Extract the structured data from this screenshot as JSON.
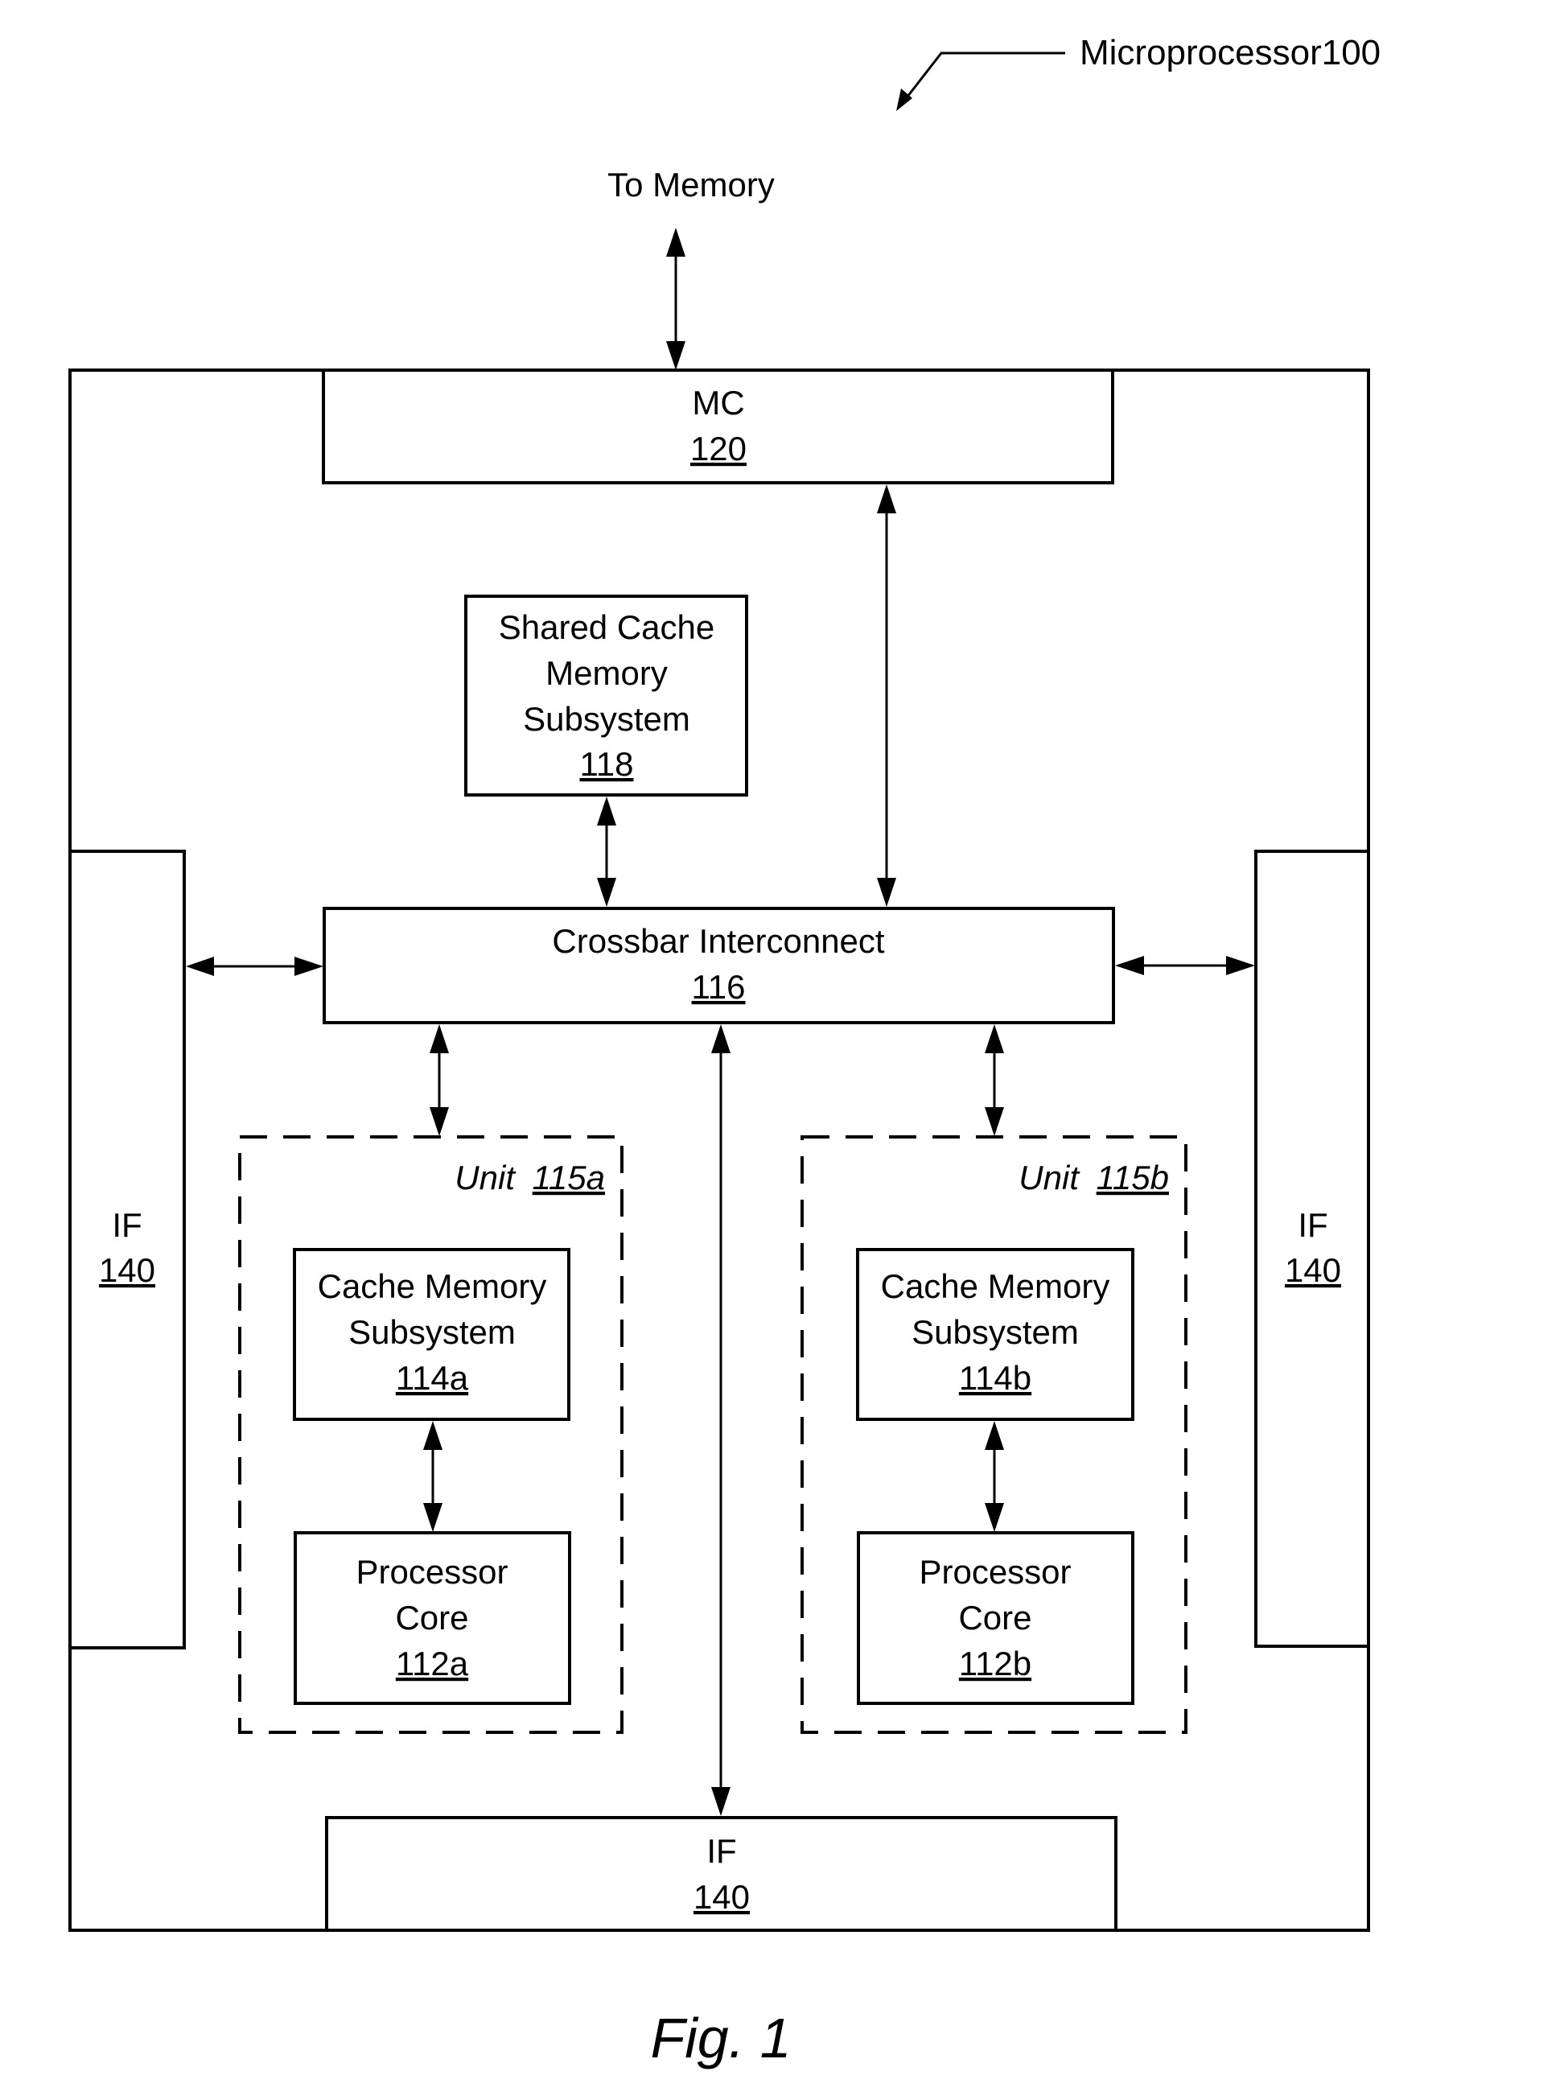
{
  "figure": {
    "reference_label": "Microprocessor100",
    "caption": "Fig. 1",
    "external_label": "To Memory"
  },
  "blocks": {
    "mc": {
      "name": "MC",
      "number": "120"
    },
    "shared_cache": {
      "lines": [
        "Shared Cache",
        "Memory",
        "Subsystem"
      ],
      "number": "118"
    },
    "crossbar": {
      "name": "Crossbar Interconnect",
      "number": "116"
    },
    "if_left": {
      "name": "IF",
      "number": "140"
    },
    "if_right": {
      "name": "IF",
      "number": "140"
    },
    "if_bottom": {
      "name": "IF",
      "number": "140"
    },
    "unit_a": {
      "label_prefix": "Unit",
      "number": "115a",
      "cache": {
        "lines": [
          "Cache Memory",
          "Subsystem"
        ],
        "number": "114a"
      },
      "core": {
        "lines": [
          "Processor",
          "Core"
        ],
        "number": "112a"
      }
    },
    "unit_b": {
      "label_prefix": "Unit",
      "number": "115b",
      "cache": {
        "lines": [
          "Cache Memory",
          "Subsystem"
        ],
        "number": "114b"
      },
      "core": {
        "lines": [
          "Processor",
          "Core"
        ],
        "number": "112b"
      }
    }
  },
  "connections": [
    {
      "from": "To Memory",
      "to": "MC 120",
      "direction": "bidirectional"
    },
    {
      "from": "MC 120",
      "to": "Crossbar Interconnect 116",
      "direction": "bidirectional"
    },
    {
      "from": "Shared Cache Memory Subsystem 118",
      "to": "Crossbar Interconnect 116",
      "direction": "bidirectional"
    },
    {
      "from": "IF 140 (left)",
      "to": "Crossbar Interconnect 116",
      "direction": "bidirectional"
    },
    {
      "from": "IF 140 (right)",
      "to": "Crossbar Interconnect 116",
      "direction": "bidirectional"
    },
    {
      "from": "IF 140 (bottom)",
      "to": "Crossbar Interconnect 116",
      "direction": "bidirectional"
    },
    {
      "from": "Unit 115a",
      "to": "Crossbar Interconnect 116",
      "direction": "bidirectional"
    },
    {
      "from": "Unit 115b",
      "to": "Crossbar Interconnect 116",
      "direction": "bidirectional"
    },
    {
      "from": "Cache Memory Subsystem 114a",
      "to": "Processor Core 112a",
      "direction": "bidirectional"
    },
    {
      "from": "Cache Memory Subsystem 114b",
      "to": "Processor Core 112b",
      "direction": "bidirectional"
    }
  ]
}
